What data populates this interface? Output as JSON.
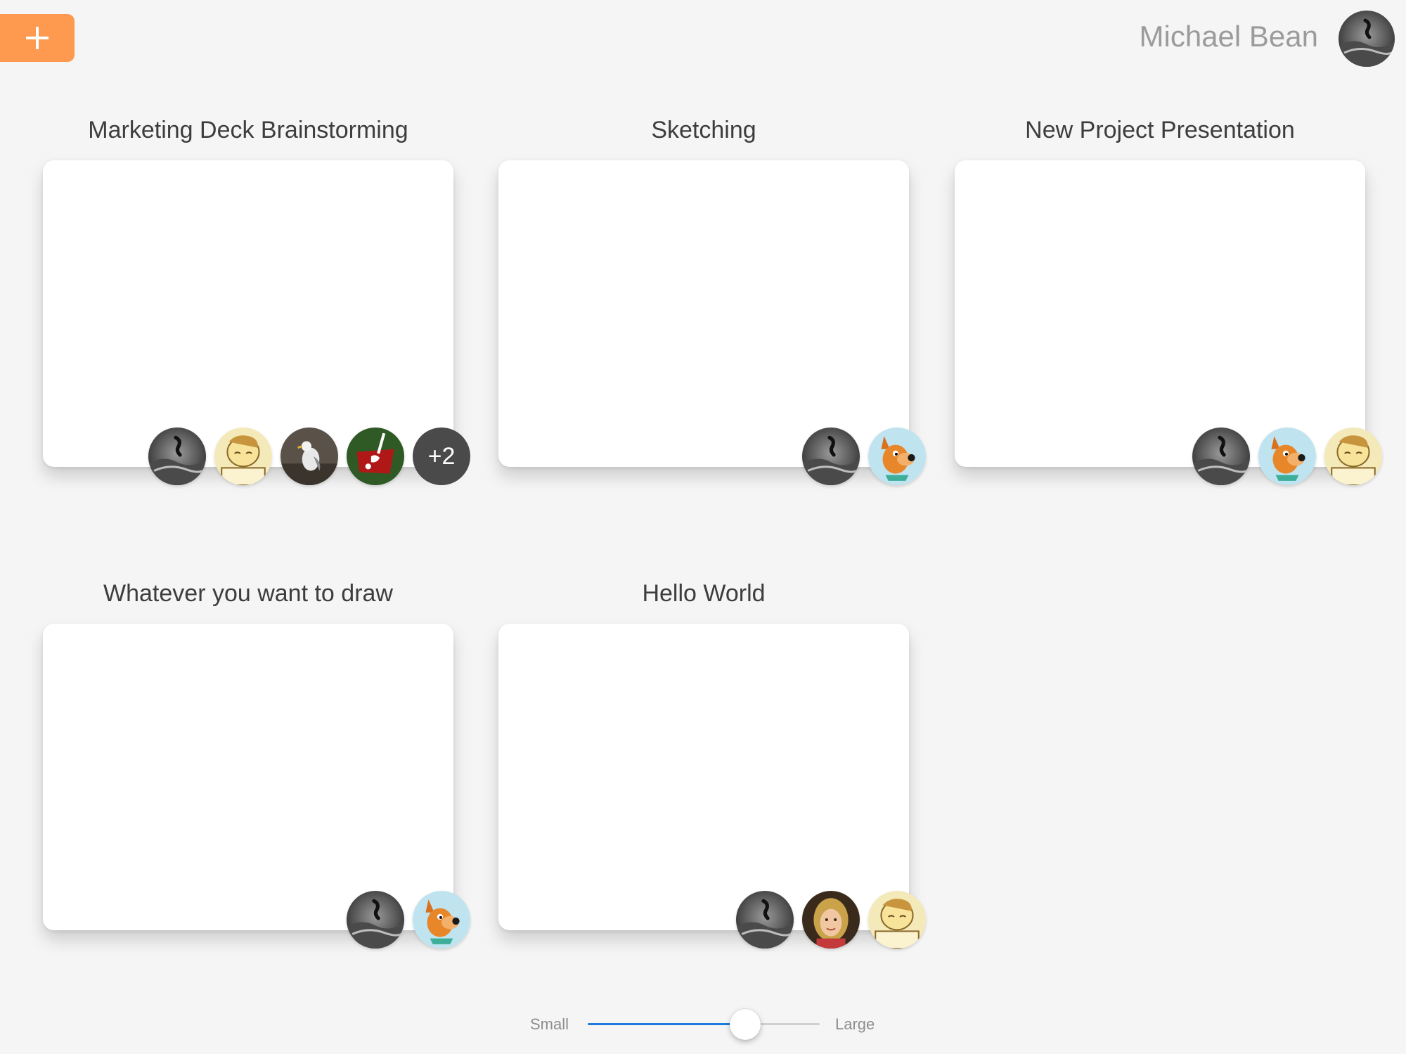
{
  "header": {
    "add_button_icon": "plus-icon",
    "accent_color": "#fd9a50",
    "user_name": "Michael Bean",
    "user_avatar": "grayscale-surfer-avatar"
  },
  "projects": [
    {
      "title": "Marketing Deck Brainstorming",
      "collaborators": [
        "grayscale-surfer-avatar",
        "cartoon-character-avatar",
        "seagull-avatar",
        "red-graphic-avatar"
      ],
      "more_count": "+2"
    },
    {
      "title": "Sketching",
      "collaborators": [
        "grayscale-surfer-avatar",
        "cartoon-dog-avatar"
      ]
    },
    {
      "title": "New Project Presentation",
      "collaborators": [
        "grayscale-surfer-avatar",
        "cartoon-dog-avatar",
        "cartoon-character-avatar"
      ]
    },
    {
      "title": "Whatever you want to draw",
      "collaborators": [
        "grayscale-surfer-avatar",
        "cartoon-dog-avatar"
      ]
    },
    {
      "title": "Hello World",
      "collaborators": [
        "grayscale-surfer-avatar",
        "girl-portrait-avatar",
        "cartoon-character-avatar"
      ]
    }
  ],
  "size_slider": {
    "min_label": "Small",
    "max_label": "Large",
    "value": 0.68,
    "fill_color": "#1f7ae0"
  }
}
